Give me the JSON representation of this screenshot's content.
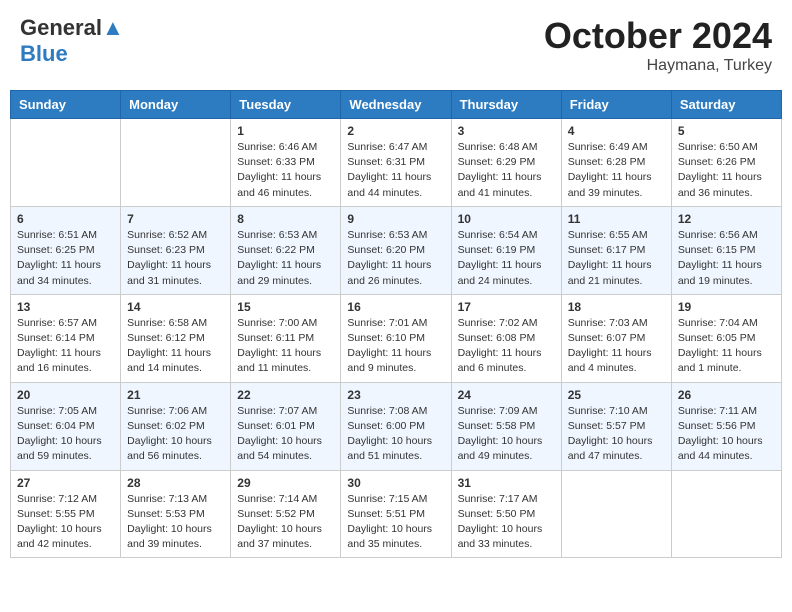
{
  "header": {
    "logo_line1": "General",
    "logo_line2": "Blue",
    "month": "October 2024",
    "location": "Haymana, Turkey"
  },
  "days_of_week": [
    "Sunday",
    "Monday",
    "Tuesday",
    "Wednesday",
    "Thursday",
    "Friday",
    "Saturday"
  ],
  "weeks": [
    [
      {
        "day": "",
        "sunrise": "",
        "sunset": "",
        "daylight": ""
      },
      {
        "day": "",
        "sunrise": "",
        "sunset": "",
        "daylight": ""
      },
      {
        "day": "1",
        "sunrise": "Sunrise: 6:46 AM",
        "sunset": "Sunset: 6:33 PM",
        "daylight": "Daylight: 11 hours and 46 minutes."
      },
      {
        "day": "2",
        "sunrise": "Sunrise: 6:47 AM",
        "sunset": "Sunset: 6:31 PM",
        "daylight": "Daylight: 11 hours and 44 minutes."
      },
      {
        "day": "3",
        "sunrise": "Sunrise: 6:48 AM",
        "sunset": "Sunset: 6:29 PM",
        "daylight": "Daylight: 11 hours and 41 minutes."
      },
      {
        "day": "4",
        "sunrise": "Sunrise: 6:49 AM",
        "sunset": "Sunset: 6:28 PM",
        "daylight": "Daylight: 11 hours and 39 minutes."
      },
      {
        "day": "5",
        "sunrise": "Sunrise: 6:50 AM",
        "sunset": "Sunset: 6:26 PM",
        "daylight": "Daylight: 11 hours and 36 minutes."
      }
    ],
    [
      {
        "day": "6",
        "sunrise": "Sunrise: 6:51 AM",
        "sunset": "Sunset: 6:25 PM",
        "daylight": "Daylight: 11 hours and 34 minutes."
      },
      {
        "day": "7",
        "sunrise": "Sunrise: 6:52 AM",
        "sunset": "Sunset: 6:23 PM",
        "daylight": "Daylight: 11 hours and 31 minutes."
      },
      {
        "day": "8",
        "sunrise": "Sunrise: 6:53 AM",
        "sunset": "Sunset: 6:22 PM",
        "daylight": "Daylight: 11 hours and 29 minutes."
      },
      {
        "day": "9",
        "sunrise": "Sunrise: 6:53 AM",
        "sunset": "Sunset: 6:20 PM",
        "daylight": "Daylight: 11 hours and 26 minutes."
      },
      {
        "day": "10",
        "sunrise": "Sunrise: 6:54 AM",
        "sunset": "Sunset: 6:19 PM",
        "daylight": "Daylight: 11 hours and 24 minutes."
      },
      {
        "day": "11",
        "sunrise": "Sunrise: 6:55 AM",
        "sunset": "Sunset: 6:17 PM",
        "daylight": "Daylight: 11 hours and 21 minutes."
      },
      {
        "day": "12",
        "sunrise": "Sunrise: 6:56 AM",
        "sunset": "Sunset: 6:15 PM",
        "daylight": "Daylight: 11 hours and 19 minutes."
      }
    ],
    [
      {
        "day": "13",
        "sunrise": "Sunrise: 6:57 AM",
        "sunset": "Sunset: 6:14 PM",
        "daylight": "Daylight: 11 hours and 16 minutes."
      },
      {
        "day": "14",
        "sunrise": "Sunrise: 6:58 AM",
        "sunset": "Sunset: 6:12 PM",
        "daylight": "Daylight: 11 hours and 14 minutes."
      },
      {
        "day": "15",
        "sunrise": "Sunrise: 7:00 AM",
        "sunset": "Sunset: 6:11 PM",
        "daylight": "Daylight: 11 hours and 11 minutes."
      },
      {
        "day": "16",
        "sunrise": "Sunrise: 7:01 AM",
        "sunset": "Sunset: 6:10 PM",
        "daylight": "Daylight: 11 hours and 9 minutes."
      },
      {
        "day": "17",
        "sunrise": "Sunrise: 7:02 AM",
        "sunset": "Sunset: 6:08 PM",
        "daylight": "Daylight: 11 hours and 6 minutes."
      },
      {
        "day": "18",
        "sunrise": "Sunrise: 7:03 AM",
        "sunset": "Sunset: 6:07 PM",
        "daylight": "Daylight: 11 hours and 4 minutes."
      },
      {
        "day": "19",
        "sunrise": "Sunrise: 7:04 AM",
        "sunset": "Sunset: 6:05 PM",
        "daylight": "Daylight: 11 hours and 1 minute."
      }
    ],
    [
      {
        "day": "20",
        "sunrise": "Sunrise: 7:05 AM",
        "sunset": "Sunset: 6:04 PM",
        "daylight": "Daylight: 10 hours and 59 minutes."
      },
      {
        "day": "21",
        "sunrise": "Sunrise: 7:06 AM",
        "sunset": "Sunset: 6:02 PM",
        "daylight": "Daylight: 10 hours and 56 minutes."
      },
      {
        "day": "22",
        "sunrise": "Sunrise: 7:07 AM",
        "sunset": "Sunset: 6:01 PM",
        "daylight": "Daylight: 10 hours and 54 minutes."
      },
      {
        "day": "23",
        "sunrise": "Sunrise: 7:08 AM",
        "sunset": "Sunset: 6:00 PM",
        "daylight": "Daylight: 10 hours and 51 minutes."
      },
      {
        "day": "24",
        "sunrise": "Sunrise: 7:09 AM",
        "sunset": "Sunset: 5:58 PM",
        "daylight": "Daylight: 10 hours and 49 minutes."
      },
      {
        "day": "25",
        "sunrise": "Sunrise: 7:10 AM",
        "sunset": "Sunset: 5:57 PM",
        "daylight": "Daylight: 10 hours and 47 minutes."
      },
      {
        "day": "26",
        "sunrise": "Sunrise: 7:11 AM",
        "sunset": "Sunset: 5:56 PM",
        "daylight": "Daylight: 10 hours and 44 minutes."
      }
    ],
    [
      {
        "day": "27",
        "sunrise": "Sunrise: 7:12 AM",
        "sunset": "Sunset: 5:55 PM",
        "daylight": "Daylight: 10 hours and 42 minutes."
      },
      {
        "day": "28",
        "sunrise": "Sunrise: 7:13 AM",
        "sunset": "Sunset: 5:53 PM",
        "daylight": "Daylight: 10 hours and 39 minutes."
      },
      {
        "day": "29",
        "sunrise": "Sunrise: 7:14 AM",
        "sunset": "Sunset: 5:52 PM",
        "daylight": "Daylight: 10 hours and 37 minutes."
      },
      {
        "day": "30",
        "sunrise": "Sunrise: 7:15 AM",
        "sunset": "Sunset: 5:51 PM",
        "daylight": "Daylight: 10 hours and 35 minutes."
      },
      {
        "day": "31",
        "sunrise": "Sunrise: 7:17 AM",
        "sunset": "Sunset: 5:50 PM",
        "daylight": "Daylight: 10 hours and 33 minutes."
      },
      {
        "day": "",
        "sunrise": "",
        "sunset": "",
        "daylight": ""
      },
      {
        "day": "",
        "sunrise": "",
        "sunset": "",
        "daylight": ""
      }
    ]
  ]
}
